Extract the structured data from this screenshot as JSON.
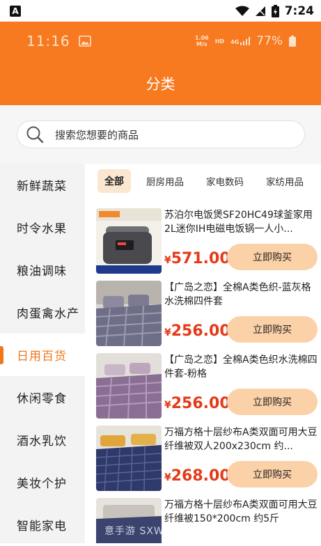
{
  "system_status": {
    "time": "7:24",
    "left_badge": "A"
  },
  "header": {
    "inner_time": "11:16",
    "net_speed_top": "1.06",
    "net_speed_bottom": "M/s",
    "hd": "HD",
    "signal_label": "4G",
    "battery": "77%",
    "title": "分类"
  },
  "search": {
    "placeholder": "搜索您想要的商品"
  },
  "sidebar": {
    "items": [
      {
        "label": "新鲜蔬菜"
      },
      {
        "label": "时令水果"
      },
      {
        "label": "粮油调味"
      },
      {
        "label": "肉蛋禽水产"
      },
      {
        "label": "日用百货"
      },
      {
        "label": "休闲零食"
      },
      {
        "label": "酒水乳饮"
      },
      {
        "label": "美妆个护"
      },
      {
        "label": "智能家电"
      }
    ],
    "active_index": 4
  },
  "tabs": [
    {
      "label": "全部"
    },
    {
      "label": "厨房用品"
    },
    {
      "label": "家电数码"
    },
    {
      "label": "家纺用品"
    }
  ],
  "products": [
    {
      "title": "苏泊尔电饭煲SF20HC49球釜家用2L迷你IH电磁电饭锅一人小...",
      "currency": "¥",
      "price": "571.00",
      "buy_label": "立即购买"
    },
    {
      "title": "【广岛之恋】全棉A类色织-蓝灰格水洗棉四件套",
      "currency": "¥",
      "price": "256.00",
      "buy_label": "立即购买"
    },
    {
      "title": "【广岛之恋】全棉A类色织水洗棉四件套-粉格",
      "currency": "¥",
      "price": "256.00",
      "buy_label": "立即购买"
    },
    {
      "title": "万福方格十层纱布A类双面可用大豆纤维被双人200x230cm 约...",
      "currency": "¥",
      "price": "268.00",
      "buy_label": "立即购买"
    },
    {
      "title": "万福方格十层纱布A类双面可用大豆纤维被150*200cm 约5斤",
      "currency": "¥",
      "price": "",
      "buy_label": ""
    }
  ],
  "watermark": "意手游 SXWYT.COM",
  "colors": {
    "accent": "#f77a20",
    "price": "#e53a19",
    "buy_button": "#fbd1a7",
    "active_tab_bg": "#fbe6d2"
  }
}
